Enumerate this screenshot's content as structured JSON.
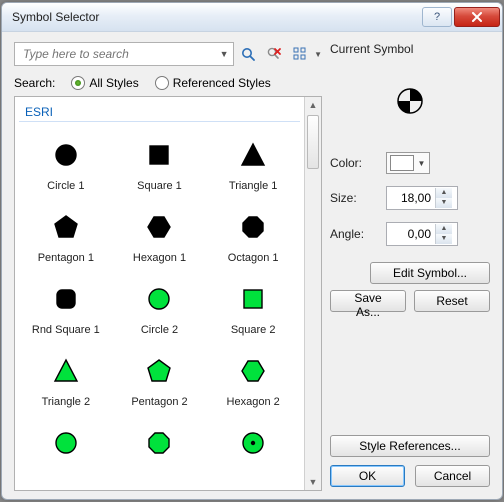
{
  "window": {
    "title": "Symbol Selector"
  },
  "search": {
    "placeholder": "Type here to search",
    "label": "Search:",
    "scope_all": "All Styles",
    "scope_ref": "Referenced Styles"
  },
  "category": "ESRI",
  "symbols": [
    {
      "label": "Circle 1",
      "shape": "circle",
      "fill": "#000000",
      "stroke": "#000000"
    },
    {
      "label": "Square 1",
      "shape": "square",
      "fill": "#000000",
      "stroke": "#000000"
    },
    {
      "label": "Triangle 1",
      "shape": "triangle",
      "fill": "#000000",
      "stroke": "#000000"
    },
    {
      "label": "Pentagon 1",
      "shape": "pentagon",
      "fill": "#000000",
      "stroke": "#000000"
    },
    {
      "label": "Hexagon 1",
      "shape": "hexagon",
      "fill": "#000000",
      "stroke": "#000000"
    },
    {
      "label": "Octagon 1",
      "shape": "octagon",
      "fill": "#000000",
      "stroke": "#000000"
    },
    {
      "label": "Rnd Square 1",
      "shape": "rsquare",
      "fill": "#000000",
      "stroke": "#000000"
    },
    {
      "label": "Circle 2",
      "shape": "circle",
      "fill": "#00e23c",
      "stroke": "#000000"
    },
    {
      "label": "Square 2",
      "shape": "square",
      "fill": "#00e23c",
      "stroke": "#000000"
    },
    {
      "label": "Triangle 2",
      "shape": "triangle",
      "fill": "#00e23c",
      "stroke": "#000000"
    },
    {
      "label": "Pentagon 2",
      "shape": "pentagon",
      "fill": "#00e23c",
      "stroke": "#000000"
    },
    {
      "label": "Hexagon 2",
      "shape": "hexagon",
      "fill": "#00e23c",
      "stroke": "#000000"
    },
    {
      "label": "",
      "shape": "circle",
      "fill": "#00e23c",
      "stroke": "#000000"
    },
    {
      "label": "",
      "shape": "octagon",
      "fill": "#00e23c",
      "stroke": "#000000"
    },
    {
      "label": "",
      "shape": "dotcircle",
      "fill": "#00e23c",
      "stroke": "#000000"
    }
  ],
  "current": {
    "heading": "Current Symbol",
    "color_label": "Color:",
    "color_value": "#ffffff",
    "size_label": "Size:",
    "size_value": "18,00",
    "angle_label": "Angle:",
    "angle_value": "0,00",
    "edit": "Edit Symbol...",
    "saveas": "Save As...",
    "reset": "Reset"
  },
  "style_refs": "Style References...",
  "footer": {
    "ok": "OK",
    "cancel": "Cancel"
  }
}
